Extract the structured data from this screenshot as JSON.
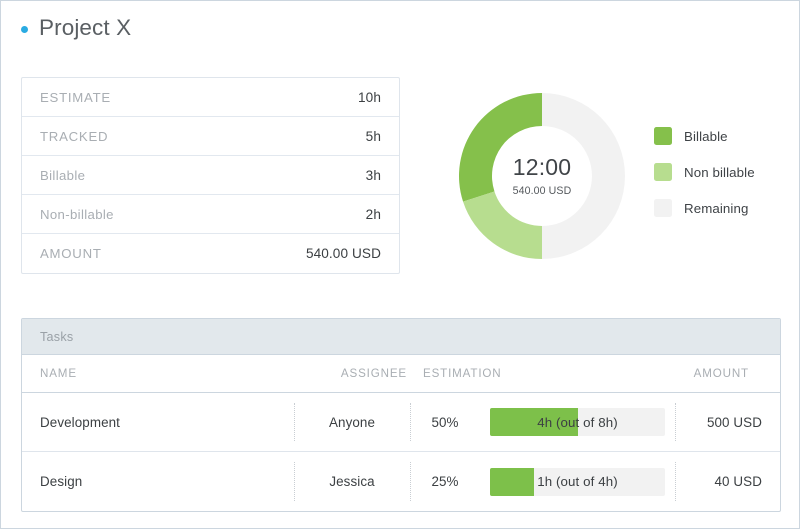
{
  "header": {
    "project_title": "Project X",
    "dot_color": "#2aabe2"
  },
  "summary": {
    "rows": [
      {
        "label": "ESTIMATE",
        "value": "10h"
      },
      {
        "label": "TRACKED",
        "value": "5h"
      },
      {
        "label": "Billable",
        "value": "3h"
      },
      {
        "label": "Non-billable",
        "value": "2h"
      },
      {
        "label": "AMOUNT",
        "value": "540.00 USD"
      }
    ]
  },
  "donut": {
    "center_main": "12:00",
    "center_sub": "540.00 USD",
    "legend": [
      {
        "label": "Billable",
        "color": "#85c04b"
      },
      {
        "label": "Non billable",
        "color": "#b7dd8f"
      },
      {
        "label": "Remaining",
        "color": "#f2f2f2"
      }
    ]
  },
  "chart_data": {
    "type": "pie",
    "title": "12:00",
    "subtitle": "540.00 USD",
    "categories": [
      "Billable",
      "Non billable",
      "Remaining"
    ],
    "values": [
      3,
      2,
      5
    ],
    "unit": "hours",
    "percentages": [
      30,
      20,
      50
    ],
    "colors": [
      "#85c04b",
      "#b7dd8f",
      "#f2f2f2"
    ],
    "total": 10,
    "legend_position": "right",
    "direction": "counterclockwise",
    "start_angle_deg": 0,
    "inner_radius_ratio": 0.6,
    "grid": false
  },
  "tasks": {
    "banner_label": "Tasks",
    "columns": [
      "NAME",
      "ASSIGNEE",
      "ESTIMATION",
      "AMOUNT"
    ],
    "rows": [
      {
        "name": "Development",
        "assignee": "Anyone",
        "percent": "50%",
        "fill_percent": 50,
        "bar_label": "4h (out of 8h)",
        "amount": "500 USD"
      },
      {
        "name": "Design",
        "assignee": "Jessica",
        "percent": "25%",
        "fill_percent": 25,
        "bar_label": "1h (out of 4h)",
        "amount": "40 USD"
      }
    ]
  }
}
